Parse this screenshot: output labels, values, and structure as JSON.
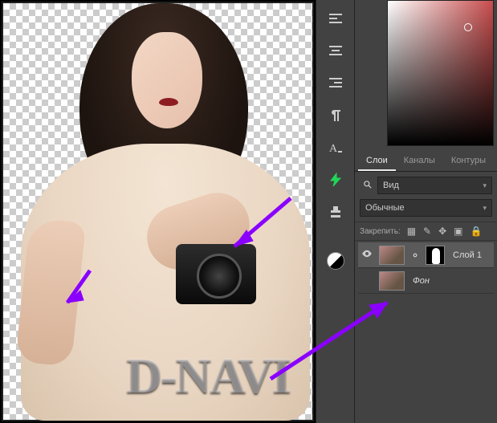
{
  "canvas": {
    "watermark": "D-NAVI"
  },
  "toolstrip_icons": [
    "align-left",
    "align-center",
    "align-right",
    "paragraph",
    "character",
    "flash",
    "stamp",
    "bw-circle"
  ],
  "tabs": [
    {
      "id": "layers",
      "label": "Слои",
      "active": true
    },
    {
      "id": "channels",
      "label": "Каналы",
      "active": false
    },
    {
      "id": "paths",
      "label": "Контуры",
      "active": false
    }
  ],
  "layers_panel": {
    "filter_label": "Вид",
    "blend_mode": "Обычные",
    "lock_label": "Закрепить:",
    "lock_icons": [
      "transparency",
      "brush",
      "move",
      "artboard",
      "all"
    ],
    "layers": [
      {
        "name": "Слой 1",
        "visible": true,
        "has_mask": true,
        "selected": true,
        "italic": false
      },
      {
        "name": "Фон",
        "visible": false,
        "has_mask": false,
        "selected": false,
        "italic": true
      }
    ]
  }
}
